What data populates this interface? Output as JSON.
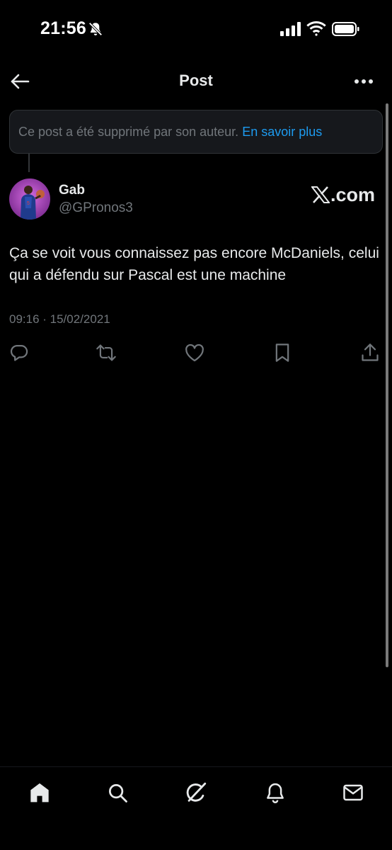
{
  "status_bar": {
    "time": "21:56",
    "icons": [
      "bell-off-icon",
      "signal-icon",
      "wifi-icon",
      "battery-icon"
    ]
  },
  "header": {
    "title": "Post",
    "left_icon": "back-arrow-icon",
    "right_icon": "more-icon"
  },
  "deleted_notice": {
    "text": "Ce post a été supprimé par son auteur.",
    "link": "En savoir plus"
  },
  "post": {
    "author_name": "Gab",
    "author_handle": "@GPronos3",
    "source_logo_text": ".com",
    "body": "Ça se voit vous connaissez pas encore McDaniels, celui qui a défendu sur Pascal est une machine",
    "timestamp": "09:16 · 15/02/2021",
    "actions": [
      "reply-icon",
      "repost-icon",
      "like-icon",
      "bookmark-icon",
      "share-icon"
    ]
  },
  "tab_bar": {
    "tabs": [
      "home-icon",
      "search-icon",
      "grok-icon",
      "notifications-icon",
      "messages-icon"
    ]
  },
  "colors": {
    "background": "#000000",
    "text_primary": "#e7e9ea",
    "text_secondary": "#71767b",
    "link": "#1d9bf0",
    "border": "#2f3336"
  }
}
